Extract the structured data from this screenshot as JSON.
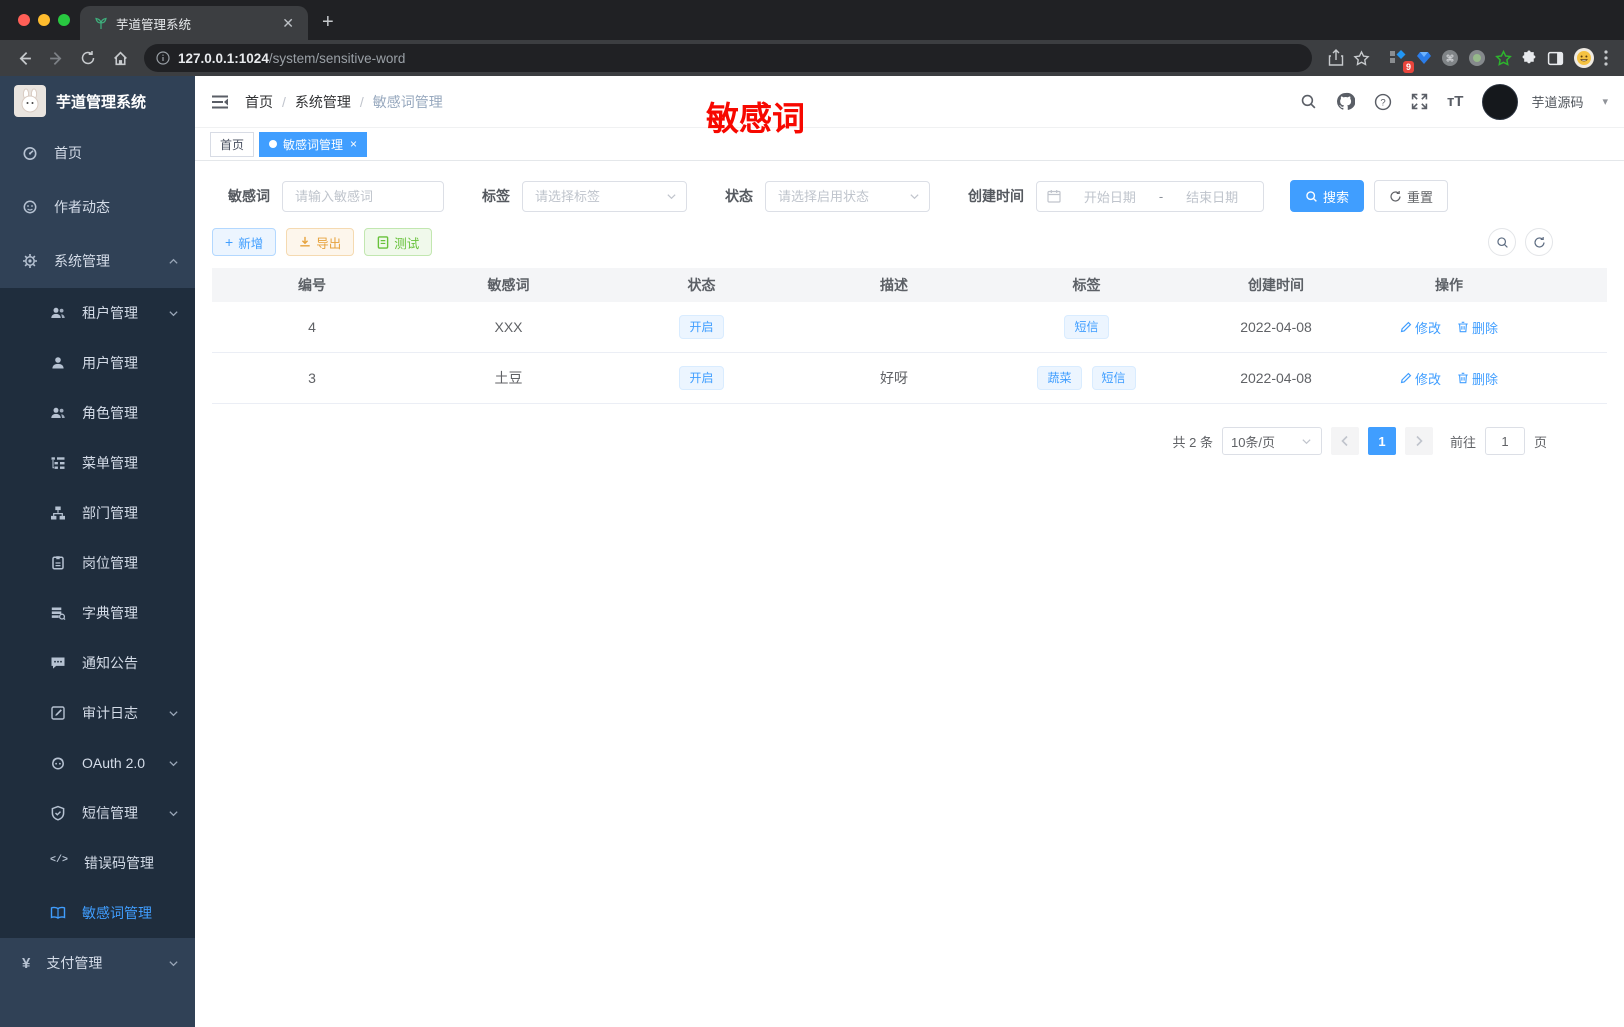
{
  "browser": {
    "tab_title": "芋道管理系统",
    "url_host": "127.0.0.1:1024",
    "url_path": "/system/sensitive-word",
    "extension_badge": "9"
  },
  "annotation": {
    "text": "敏感词",
    "color": "#f70800"
  },
  "sidebar": {
    "title": "芋道管理系统",
    "items": {
      "home": "首页",
      "author": "作者动态",
      "system": "系统管理",
      "tenant": "租户管理",
      "user": "用户管理",
      "role": "角色管理",
      "menu": "菜单管理",
      "dept": "部门管理",
      "post": "岗位管理",
      "dict": "字典管理",
      "notice": "通知公告",
      "audit": "审计日志",
      "oauth": "OAuth 2.0",
      "sms": "短信管理",
      "errcode": "错误码管理",
      "sensitive": "敏感词管理",
      "pay": "支付管理"
    }
  },
  "header": {
    "breadcrumb": [
      "首页",
      "系统管理",
      "敏感词管理"
    ],
    "username": "芋道源码"
  },
  "tags_view": {
    "tab_home": "首页",
    "tab_active": "敏感词管理"
  },
  "filters": {
    "word_label": "敏感词",
    "word_placeholder": "请输入敏感词",
    "tag_label": "标签",
    "tag_placeholder": "请选择标签",
    "status_label": "状态",
    "status_placeholder": "请选择启用状态",
    "date_label": "创建时间",
    "date_start_placeholder": "开始日期",
    "date_separator": "-",
    "date_end_placeholder": "结束日期",
    "search_label": "搜索",
    "reset_label": "重置"
  },
  "toolbar": {
    "add_label": "新增",
    "export_label": "导出",
    "test_label": "测试"
  },
  "table": {
    "columns": [
      "编号",
      "敏感词",
      "状态",
      "描述",
      "标签",
      "创建时间",
      "操作"
    ],
    "rows": [
      {
        "id": "4",
        "word": "XXX",
        "status": "开启",
        "description": "",
        "tags": [
          "短信"
        ],
        "created_at": "2022-04-08"
      },
      {
        "id": "3",
        "word": "土豆",
        "status": "开启",
        "description": "好呀",
        "tags": [
          "蔬菜",
          "短信"
        ],
        "created_at": "2022-04-08"
      }
    ],
    "edit_label": "修改",
    "delete_label": "删除"
  },
  "pagination": {
    "total_text": "共 2 条",
    "size_text": "10条/页",
    "current_page": "1",
    "goto_label": "前往",
    "goto_value": "1",
    "unit_label": "页"
  },
  "colors": {
    "primary": "#409eff",
    "warning": "#e6a23c",
    "success": "#67c23a",
    "sidebar_bg": "#304156",
    "submenu_bg": "#1f2d3d"
  },
  "glyphs": {
    "code_icon": "</>",
    "yen_icon": "¥",
    "caret_down": "▾"
  }
}
